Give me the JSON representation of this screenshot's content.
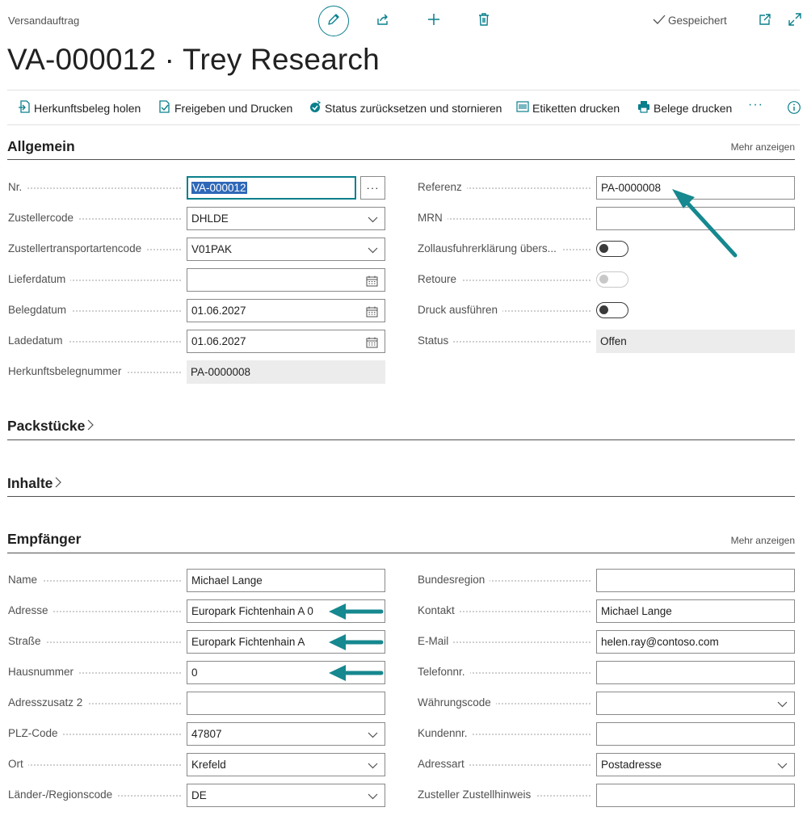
{
  "header": {
    "page_type": "Versandauftrag",
    "title": "VA-000012 · Trey Research",
    "saved_label": "Gespeichert"
  },
  "actions": {
    "get_source": "Herkunftsbeleg holen",
    "release_print": "Freigeben und Drucken",
    "reset_cancel": "Status zurücksetzen und stornieren",
    "print_labels": "Etiketten drucken",
    "print_docs": "Belege drucken",
    "more": "···"
  },
  "general": {
    "title": "Allgemein",
    "show_more": "Mehr anzeigen",
    "left": [
      {
        "label": "Nr.",
        "value": "VA-000012"
      },
      {
        "label": "Zustellercode",
        "value": "DHLDE"
      },
      {
        "label": "Zustellertransportartencode",
        "value": "V01PAK"
      },
      {
        "label": "Lieferdatum",
        "value": ""
      },
      {
        "label": "Belegdatum",
        "value": "01.06.2027"
      },
      {
        "label": "Ladedatum",
        "value": "01.06.2027"
      },
      {
        "label": "Herkunftsbelegnummer",
        "value": "PA-0000008"
      }
    ],
    "right": [
      {
        "label": "Referenz",
        "value": "PA-0000008"
      },
      {
        "label": "MRN",
        "value": ""
      },
      {
        "label": "Zollausfuhrerklärung übers...",
        "value": "off"
      },
      {
        "label": "Retoure",
        "value": "off"
      },
      {
        "label": "Druck ausführen",
        "value": "off"
      },
      {
        "label": "Status",
        "value": "Offen"
      }
    ]
  },
  "packages": {
    "title": "Packstücke"
  },
  "contents": {
    "title": "Inhalte"
  },
  "recipient": {
    "title": "Empfänger",
    "show_more": "Mehr anzeigen",
    "left": [
      {
        "label": "Name",
        "value": "Michael Lange"
      },
      {
        "label": "Adresse",
        "value": "Europark Fichtenhain A 0"
      },
      {
        "label": "Straße",
        "value": "Europark Fichtenhain A"
      },
      {
        "label": "Hausnummer",
        "value": "0"
      },
      {
        "label": "Adresszusatz 2",
        "value": ""
      },
      {
        "label": "PLZ-Code",
        "value": "47807"
      },
      {
        "label": "Ort",
        "value": "Krefeld"
      },
      {
        "label": "Länder-/Regionscode",
        "value": "DE"
      }
    ],
    "right": [
      {
        "label": "Bundesregion",
        "value": ""
      },
      {
        "label": "Kontakt",
        "value": "Michael Lange"
      },
      {
        "label": "E-Mail",
        "value": "helen.ray@contoso.com"
      },
      {
        "label": "Telefonnr.",
        "value": ""
      },
      {
        "label": "Währungscode",
        "value": ""
      },
      {
        "label": "Kundennr.",
        "value": ""
      },
      {
        "label": "Adressart",
        "value": "Postadresse"
      },
      {
        "label": "Zusteller Zustellhinweis",
        "value": ""
      }
    ]
  },
  "colors": {
    "accent": "#0a7f8c",
    "selection": "#2e68b8",
    "readonly_bg": "#ececec"
  }
}
